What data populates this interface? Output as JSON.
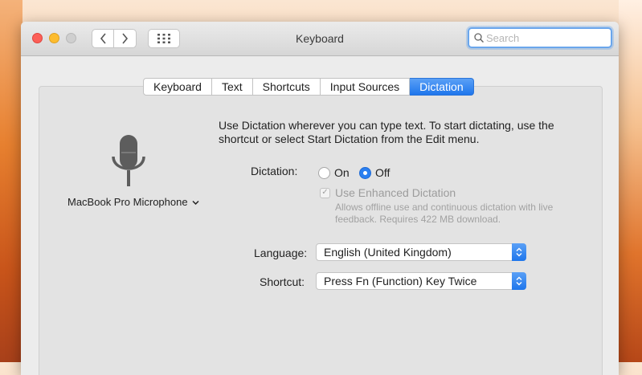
{
  "window": {
    "title": "Keyboard"
  },
  "search": {
    "placeholder": "Search",
    "value": ""
  },
  "tabs": [
    {
      "label": "Keyboard"
    },
    {
      "label": "Text"
    },
    {
      "label": "Shortcuts"
    },
    {
      "label": "Input Sources"
    },
    {
      "label": "Dictation",
      "active": true
    }
  ],
  "microphone": {
    "label": "MacBook Pro Microphone",
    "icon": "chevron-down-icon"
  },
  "description": "Use Dictation wherever you can type text. To start dictating, use the shortcut or select Start Dictation from the Edit menu.",
  "dictation": {
    "label": "Dictation:",
    "options": [
      {
        "label": "On",
        "selected": false
      },
      {
        "label": "Off",
        "selected": true
      }
    ]
  },
  "enhanced": {
    "label": "Use Enhanced Dictation",
    "checked": true,
    "enabled": false,
    "note": "Allows offline use and continuous dictation with live feedback. Requires 422 MB download."
  },
  "language": {
    "label": "Language:",
    "value": "English (United Kingdom)"
  },
  "shortcut": {
    "label": "Shortcut:",
    "value": "Press Fn (Function) Key Twice"
  },
  "colors": {
    "accent": "#1e76ec",
    "close": "#fc5f57",
    "minimize": "#fdbc2e"
  }
}
